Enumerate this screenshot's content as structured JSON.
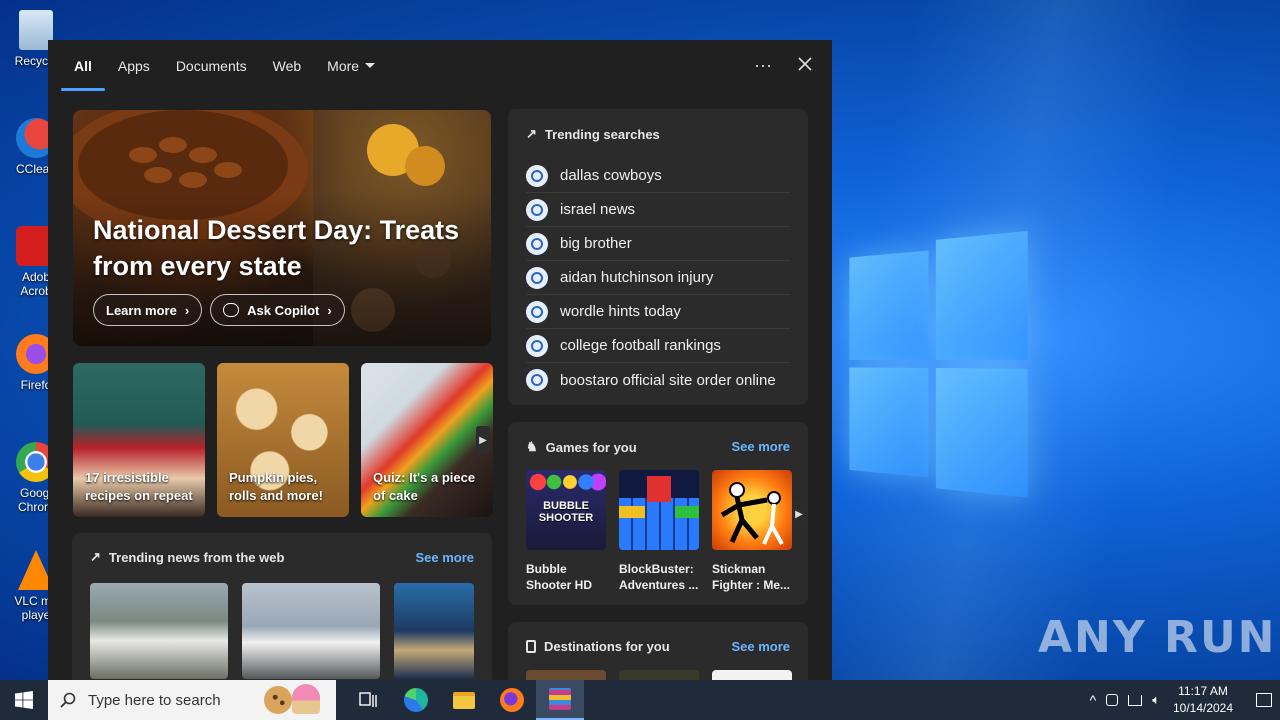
{
  "desktop": {
    "icons": [
      {
        "label": "Recycle",
        "name": "recycle-bin-icon"
      },
      {
        "label": "CClean",
        "name": "ccleaner-icon"
      },
      {
        "label": "Adob Acrob",
        "name": "adobe-acrobat-icon"
      },
      {
        "label": "Firefo",
        "name": "firefox-desktop-icon"
      },
      {
        "label": "Googl Chrom",
        "name": "chrome-icon"
      },
      {
        "label": "VLC me playe",
        "name": "vlc-icon"
      }
    ],
    "watermark": "ANY RUN"
  },
  "panel": {
    "tabs": [
      {
        "label": "All",
        "active": true
      },
      {
        "label": "Apps",
        "active": false
      },
      {
        "label": "Documents",
        "active": false
      },
      {
        "label": "Web",
        "active": false
      },
      {
        "label": "More",
        "active": false
      }
    ],
    "more_icon": "ellipsis-icon",
    "close_icon": "close-icon"
  },
  "hero": {
    "title": "National Dessert Day: Treats from every state",
    "learn_more": "Learn more",
    "ask_copilot": "Ask Copilot"
  },
  "cards": [
    {
      "label": "17 irresistible recipes on repeat"
    },
    {
      "label": "Pumpkin pies, rolls and more!"
    },
    {
      "label": "Quiz: It's a piece of cake"
    }
  ],
  "trending": {
    "title": "Trending searches",
    "items": [
      "dallas cowboys",
      "israel news",
      "big brother",
      "aidan hutchinson injury",
      "wordle hints today",
      "college football rankings",
      "boostaro official site order online"
    ]
  },
  "games": {
    "title": "Games for you",
    "see_more": "See more",
    "items": [
      {
        "name": "Bubble Shooter HD",
        "logo": "BUBBLE SHOOTER"
      },
      {
        "name": "BlockBuster: Adventures ..."
      },
      {
        "name": "Stickman Fighter : Me..."
      }
    ]
  },
  "destinations": {
    "title": "Destinations for you",
    "see_more": "See more"
  },
  "news": {
    "title": "Trending news from the web",
    "see_more": "See more"
  },
  "taskbar": {
    "search_placeholder": "Type here to search",
    "time": "11:17 AM",
    "date": "10/14/2024"
  },
  "colors": {
    "accent": "#4ca0ff",
    "link": "#6cb6ff",
    "panel": "#202020",
    "box": "#2b2b2b"
  }
}
